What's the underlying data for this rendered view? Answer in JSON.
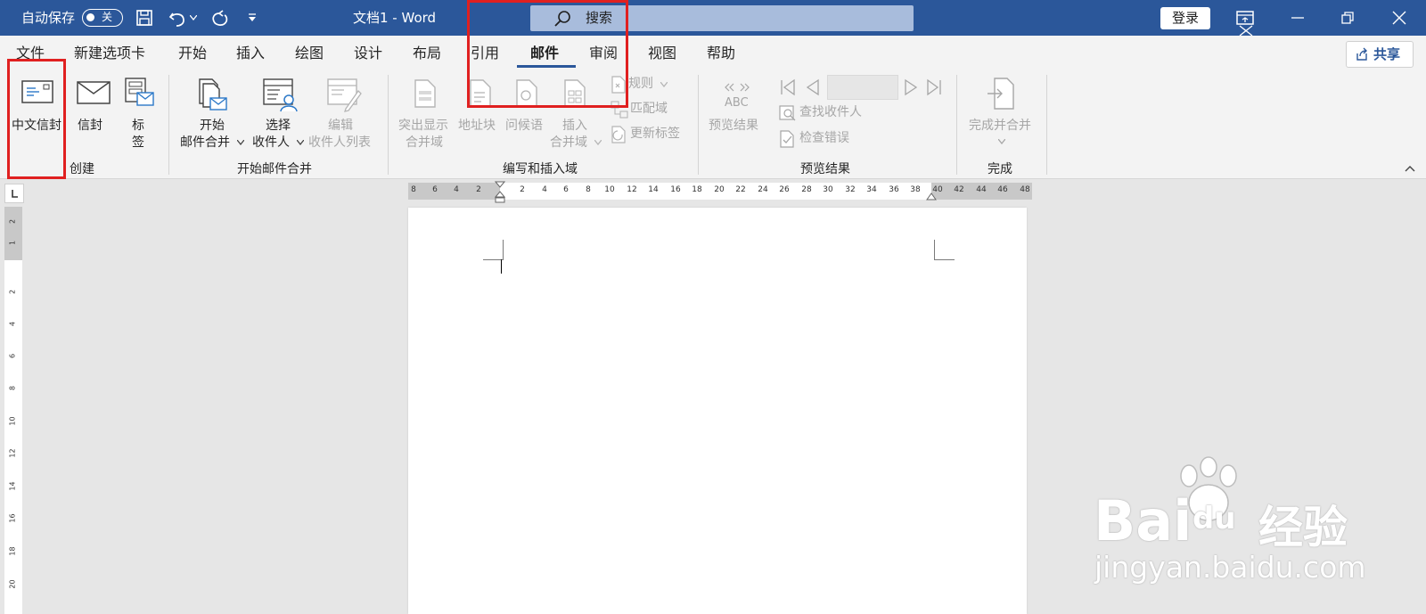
{
  "titlebar": {
    "autosave_label": "自动保存",
    "autosave_state": "关",
    "doc_title": "文档1 - Word",
    "search_placeholder": "搜索",
    "login_label": "登录",
    "bg_color": "#2b579a"
  },
  "menu": {
    "tabs": [
      "文件",
      "新建选项卡",
      "开始",
      "插入",
      "绘图",
      "设计",
      "布局",
      "引用",
      "邮件",
      "审阅",
      "视图",
      "帮助"
    ],
    "active_tab": "邮件",
    "share_label": "共享"
  },
  "ribbon": {
    "create": {
      "label": "创建",
      "chinese_envelope": "中文信封",
      "envelope": "信封",
      "labels_line1": "标",
      "labels_line2": "签"
    },
    "start_merge": {
      "label": "开始邮件合并",
      "start_line1": "开始",
      "start_line2": "邮件合并",
      "select_line1": "选择",
      "select_line2": "收件人",
      "edit_line1": "编辑",
      "edit_line2": "收件人列表"
    },
    "write_insert": {
      "label": "编写和插入域",
      "highlight_line1": "突出显示",
      "highlight_line2": "合并域",
      "address_block": "地址块",
      "greeting": "问候语",
      "insert_line1": "插入",
      "insert_line2": "合并域",
      "rules": "规则",
      "match_fields": "匹配域",
      "update_labels": "更新标签"
    },
    "preview": {
      "label": "预览结果",
      "abc": "ABC",
      "preview_results": "预览结果",
      "find_recipient": "查找收件人",
      "check_errors": "检查错误"
    },
    "finish": {
      "label": "完成",
      "finish_merge": "完成并合并"
    }
  },
  "ruler": {
    "h_numbers": [
      "8",
      "6",
      "4",
      "2",
      "2",
      "4",
      "6",
      "8",
      "10",
      "12",
      "14",
      "16",
      "18",
      "20",
      "22",
      "24",
      "26",
      "28",
      "30",
      "32",
      "34",
      "36",
      "38",
      "40",
      "42",
      "44",
      "46",
      "48"
    ],
    "v_numbers": [
      "2",
      "1",
      "2",
      "4",
      "6",
      "8",
      "10",
      "12",
      "14",
      "16",
      "18",
      "20"
    ]
  },
  "watermark": {
    "brand": "Bai",
    "du": "du",
    "jingyan": "经验",
    "url": "jingyan.baidu.com"
  },
  "colors": {
    "accent": "#2b579a",
    "annotation_red": "#e02020"
  }
}
